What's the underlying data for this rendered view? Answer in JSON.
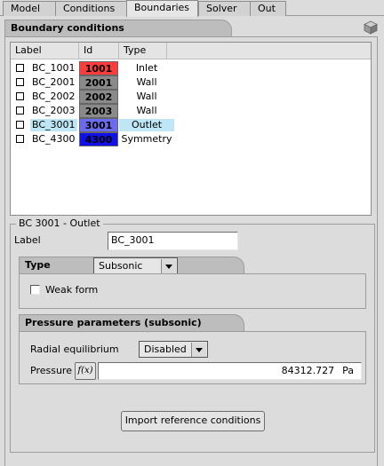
{
  "tabs": [
    "Model",
    "Conditions",
    "Boundaries",
    "Solver",
    "Out"
  ],
  "active_tab": "Boundaries",
  "section_title": "Boundary conditions",
  "table": {
    "columns": [
      "Label",
      "Id",
      "Type"
    ],
    "rows": [
      {
        "label": "BC_1001",
        "id": "1001",
        "type": "Inlet",
        "color": "#ff3b3b",
        "selected": false
      },
      {
        "label": "BC_2001",
        "id": "2001",
        "type": "Wall",
        "color": "#8a8a8a",
        "selected": false
      },
      {
        "label": "BC_2002",
        "id": "2002",
        "type": "Wall",
        "color": "#8a8a8a",
        "selected": false
      },
      {
        "label": "BC_2003",
        "id": "2003",
        "type": "Wall",
        "color": "#8a8a8a",
        "selected": false
      },
      {
        "label": "BC_3001",
        "id": "3001",
        "type": "Outlet",
        "color": "#6b6bf0",
        "selected": true
      },
      {
        "label": "BC_4300",
        "id": "4300",
        "type": "Symmetry",
        "color": "#1010e8",
        "selected": false
      }
    ]
  },
  "detail": {
    "group_title": "BC 3001 -  Outlet",
    "label_caption": "Label",
    "label_value": "BC_3001",
    "type_section": "Type",
    "type_value": "Subsonic",
    "weak_form_label": "Weak form",
    "pressure_section": "Pressure parameters (subsonic)",
    "radial_label": "Radial equilibrium",
    "radial_value": "Disabled",
    "pressure_label": "Pressure",
    "fx_label": "f(x)",
    "pressure_value": "84312.727",
    "pressure_unit": "Pa",
    "import_button": "Import reference conditions"
  },
  "icons": {
    "corner": "cube-icon"
  }
}
